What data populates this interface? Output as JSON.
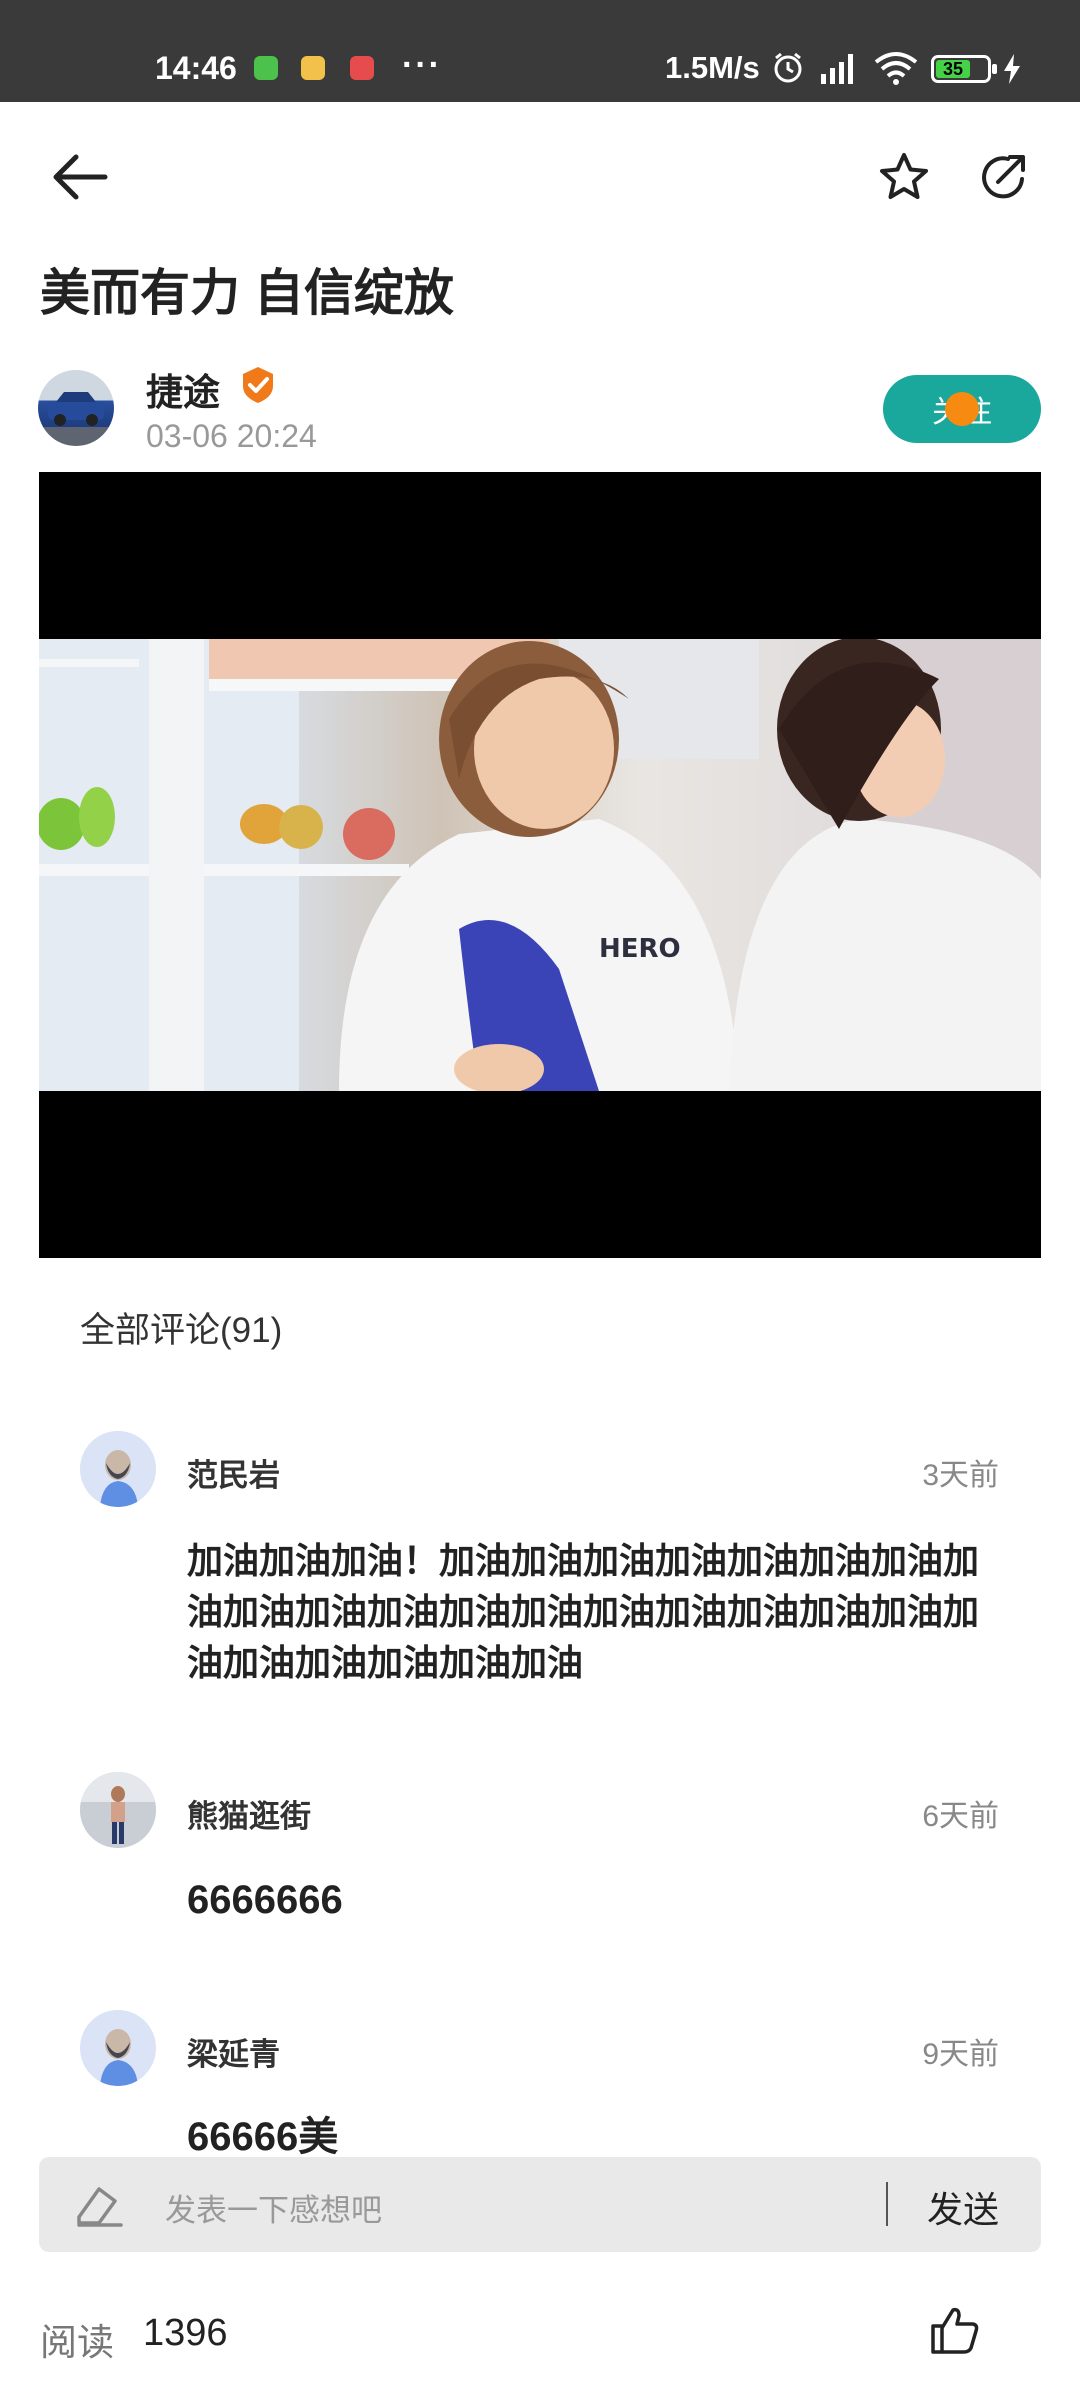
{
  "status_bar": {
    "time": "14:46",
    "more_dots": "···",
    "net_speed": "1.5M/s",
    "battery": "35",
    "colors": {
      "bg": "#3a3a3a",
      "battery_fill": "#46d246"
    }
  },
  "header": {
    "back_icon": "arrow-left-icon",
    "favorite_icon": "star-icon",
    "share_icon": "share-icon"
  },
  "post": {
    "title": "美而有力 自信绽放",
    "author": {
      "name": "捷途",
      "time": "03-06 20:24",
      "follow_label": "关注",
      "colors": {
        "follow_bg": "#1aa79c",
        "verified": "#f07a1a"
      }
    },
    "video": {
      "shirt_text": "HERO"
    }
  },
  "comments": {
    "header": "全部评论(91)",
    "items": [
      {
        "user": "范民岩",
        "time": "3天前",
        "text": "加油加油加油！加油加油加油加油加油加油加油加油加油加油加油加油加油加油加油加油加油加油加油加油加油加油加油加油"
      },
      {
        "user": "熊猫逛街",
        "time": "6天前",
        "text": "6666666"
      },
      {
        "user": "梁延青",
        "time": "9天前",
        "text": "66666美"
      }
    ]
  },
  "input": {
    "placeholder": "发表一下感想吧",
    "send_label": "发送",
    "edit_icon": "pencil-icon"
  },
  "footer": {
    "read_label": "阅读",
    "read_count": "1396",
    "like_icon": "thumbs-up-icon"
  }
}
